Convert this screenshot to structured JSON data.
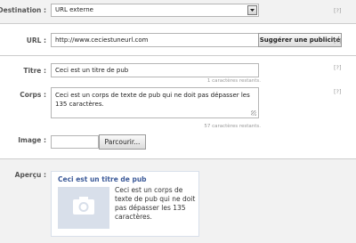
{
  "destination": {
    "label": "Destination :",
    "value": "URL externe",
    "help": "[?]"
  },
  "url": {
    "label": "URL :",
    "value": "http://www.ceciestuneurl.com",
    "button": "Suggérer une publicité",
    "help": "[?]"
  },
  "title": {
    "label": "Titre :",
    "value": "Ceci est un titre de pub",
    "remaining": "1 caractères restants.",
    "help": "[?]"
  },
  "body": {
    "label": "Corps :",
    "value": "Ceci est un corps de texte de pub qui ne doit pas dépasser les 135 caractères.",
    "remaining": "57 caractères restants.",
    "help": "[?]"
  },
  "image": {
    "label": "Image :",
    "button": "Parcourir..."
  },
  "preview": {
    "label": "Aperçu :",
    "title": "Ceci est un titre de pub",
    "body": "Ceci est un corps de texte de pub qui ne doit pas dépasser les 135 caractères.",
    "image_icon": "camera-placeholder-icon"
  },
  "colors": {
    "link_blue": "#3b5998",
    "placeholder_bg": "#d8dfea",
    "placeholder_fg": "#ffffff"
  }
}
